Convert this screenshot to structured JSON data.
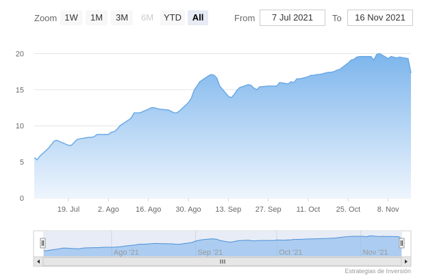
{
  "range_selector": {
    "zoom_label": "Zoom",
    "buttons": [
      {
        "label": "1W",
        "state": "normal"
      },
      {
        "label": "1M",
        "state": "normal"
      },
      {
        "label": "3M",
        "state": "normal"
      },
      {
        "label": "6M",
        "state": "disabled"
      },
      {
        "label": "YTD",
        "state": "normal"
      },
      {
        "label": "All",
        "state": "active"
      }
    ],
    "from_label": "From",
    "from_value": "7 Jul 2021",
    "to_label": "To",
    "to_value": "16 Nov 2021"
  },
  "credit": "Estrategias de Inversión",
  "navigator": {
    "labels": [
      {
        "label": "Ago '21",
        "date": "2021-08-01"
      },
      {
        "label": "Sep '21",
        "date": "2021-09-01"
      },
      {
        "label": "Oct '21",
        "date": "2021-10-01"
      },
      {
        "label": "Nov '21",
        "date": "2021-11-01"
      }
    ],
    "scroll_grip_icon": "grip-lines-icon",
    "left_arrow_icon": "arrow-left-icon",
    "right_arrow_icon": "arrow-right-icon",
    "handle_icon": "handle-grip-icon"
  },
  "chart_data": {
    "type": "area",
    "title": "",
    "xlabel": "",
    "ylabel": "",
    "x_range": [
      "2021-07-07",
      "2021-11-16"
    ],
    "ylim": [
      0,
      22.5
    ],
    "y_ticks": [
      0,
      5,
      10,
      15,
      20
    ],
    "x_ticks": [
      {
        "label": "19. Jul",
        "date": "2021-07-19"
      },
      {
        "label": "2. Ago",
        "date": "2021-08-02"
      },
      {
        "label": "16. Ago",
        "date": "2021-08-16"
      },
      {
        "label": "30. Ago",
        "date": "2021-08-30"
      },
      {
        "label": "13. Sep",
        "date": "2021-09-13"
      },
      {
        "label": "27. Sep",
        "date": "2021-09-27"
      },
      {
        "label": "11. Oct",
        "date": "2021-10-11"
      },
      {
        "label": "25. Oct",
        "date": "2021-10-25"
      },
      {
        "label": "8. Nov",
        "date": "2021-11-08"
      }
    ],
    "grid": true,
    "colors": {
      "line": "#6aa9e6",
      "fill_top": "#7cb5ec",
      "fill_bottom": "#eef5fd",
      "grid": "#e6e6e6"
    },
    "series": [
      {
        "points": [
          [
            "2021-07-07",
            5.6
          ],
          [
            "2021-07-08",
            5.3
          ],
          [
            "2021-07-09",
            5.8
          ],
          [
            "2021-07-12",
            6.9
          ],
          [
            "2021-07-13",
            7.4
          ],
          [
            "2021-07-14",
            7.9
          ],
          [
            "2021-07-15",
            8.0
          ],
          [
            "2021-07-16",
            7.8
          ],
          [
            "2021-07-19",
            7.3
          ],
          [
            "2021-07-20",
            7.3
          ],
          [
            "2021-07-21",
            7.7
          ],
          [
            "2021-07-22",
            8.1
          ],
          [
            "2021-07-23",
            8.2
          ],
          [
            "2021-07-26",
            8.4
          ],
          [
            "2021-07-27",
            8.4
          ],
          [
            "2021-07-28",
            8.5
          ],
          [
            "2021-07-29",
            8.8
          ],
          [
            "2021-07-30",
            8.8
          ],
          [
            "2021-08-02",
            8.8
          ],
          [
            "2021-08-03",
            9.1
          ],
          [
            "2021-08-04",
            9.2
          ],
          [
            "2021-08-05",
            9.5
          ],
          [
            "2021-08-06",
            10.0
          ],
          [
            "2021-08-09",
            10.8
          ],
          [
            "2021-08-10",
            11.1
          ],
          [
            "2021-08-11",
            11.8
          ],
          [
            "2021-08-12",
            11.8
          ],
          [
            "2021-08-13",
            11.8
          ],
          [
            "2021-08-16",
            12.3
          ],
          [
            "2021-08-17",
            12.5
          ],
          [
            "2021-08-18",
            12.5
          ],
          [
            "2021-08-19",
            12.4
          ],
          [
            "2021-08-20",
            12.3
          ],
          [
            "2021-08-23",
            12.2
          ],
          [
            "2021-08-24",
            12.0
          ],
          [
            "2021-08-25",
            11.8
          ],
          [
            "2021-08-26",
            11.8
          ],
          [
            "2021-08-27",
            12.1
          ],
          [
            "2021-08-30",
            13.2
          ],
          [
            "2021-08-31",
            13.8
          ],
          [
            "2021-09-01",
            14.9
          ],
          [
            "2021-09-02",
            15.5
          ],
          [
            "2021-09-03",
            16.1
          ],
          [
            "2021-09-06",
            16.9
          ],
          [
            "2021-09-07",
            17.1
          ],
          [
            "2021-09-08",
            17.0
          ],
          [
            "2021-09-09",
            16.6
          ],
          [
            "2021-09-10",
            15.5
          ],
          [
            "2021-09-13",
            14.1
          ],
          [
            "2021-09-14",
            13.9
          ],
          [
            "2021-09-15",
            14.3
          ],
          [
            "2021-09-16",
            14.9
          ],
          [
            "2021-09-17",
            15.3
          ],
          [
            "2021-09-20",
            15.7
          ],
          [
            "2021-09-21",
            15.6
          ],
          [
            "2021-09-22",
            15.2
          ],
          [
            "2021-09-23",
            15.0
          ],
          [
            "2021-09-24",
            15.4
          ],
          [
            "2021-09-27",
            15.5
          ],
          [
            "2021-09-28",
            15.5
          ],
          [
            "2021-09-29",
            15.5
          ],
          [
            "2021-09-30",
            15.5
          ],
          [
            "2021-10-01",
            16.0
          ],
          [
            "2021-10-04",
            15.8
          ],
          [
            "2021-10-05",
            16.1
          ],
          [
            "2021-10-06",
            16.0
          ],
          [
            "2021-10-07",
            16.5
          ],
          [
            "2021-10-08",
            16.5
          ],
          [
            "2021-10-11",
            16.8
          ],
          [
            "2021-10-12",
            17.0
          ],
          [
            "2021-10-13",
            17.0
          ],
          [
            "2021-10-14",
            17.1
          ],
          [
            "2021-10-15",
            17.1
          ],
          [
            "2021-10-18",
            17.4
          ],
          [
            "2021-10-19",
            17.4
          ],
          [
            "2021-10-20",
            17.5
          ],
          [
            "2021-10-21",
            17.7
          ],
          [
            "2021-10-22",
            17.8
          ],
          [
            "2021-10-25",
            18.7
          ],
          [
            "2021-10-26",
            19.1
          ],
          [
            "2021-10-27",
            19.2
          ],
          [
            "2021-10-28",
            19.5
          ],
          [
            "2021-10-29",
            19.6
          ],
          [
            "2021-11-01",
            19.6
          ],
          [
            "2021-11-02",
            19.6
          ],
          [
            "2021-11-03",
            19.1
          ],
          [
            "2021-11-04",
            19.9
          ],
          [
            "2021-11-05",
            20.0
          ],
          [
            "2021-11-08",
            19.3
          ],
          [
            "2021-11-09",
            19.6
          ],
          [
            "2021-11-10",
            19.5
          ],
          [
            "2021-11-11",
            19.4
          ],
          [
            "2021-11-12",
            19.5
          ],
          [
            "2021-11-15",
            19.3
          ],
          [
            "2021-11-16",
            17.3
          ]
        ]
      }
    ]
  }
}
